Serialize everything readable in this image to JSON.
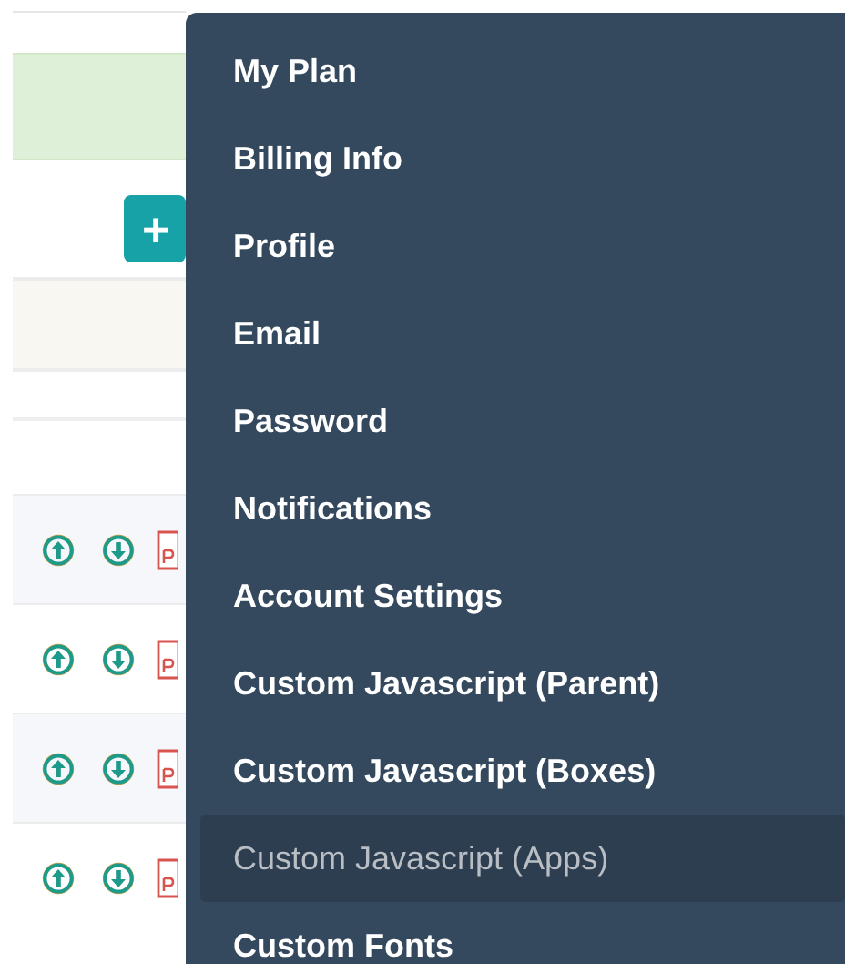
{
  "add_button": {
    "label": "+"
  },
  "rows": [
    {
      "kind": "file"
    },
    {
      "kind": "file"
    },
    {
      "kind": "file"
    },
    {
      "kind": "file"
    }
  ],
  "menu": {
    "items": [
      {
        "label": "My Plan",
        "selected": false
      },
      {
        "label": "Billing Info",
        "selected": false
      },
      {
        "label": "Profile",
        "selected": false
      },
      {
        "label": "Email",
        "selected": false
      },
      {
        "label": "Password",
        "selected": false
      },
      {
        "label": "Notifications",
        "selected": false
      },
      {
        "label": "Account Settings",
        "selected": false
      },
      {
        "label": "Custom Javascript (Parent)",
        "selected": false
      },
      {
        "label": "Custom Javascript (Boxes)",
        "selected": false
      },
      {
        "label": "Custom Javascript (Apps)",
        "selected": true
      },
      {
        "label": "Custom Fonts",
        "selected": false
      }
    ]
  }
}
